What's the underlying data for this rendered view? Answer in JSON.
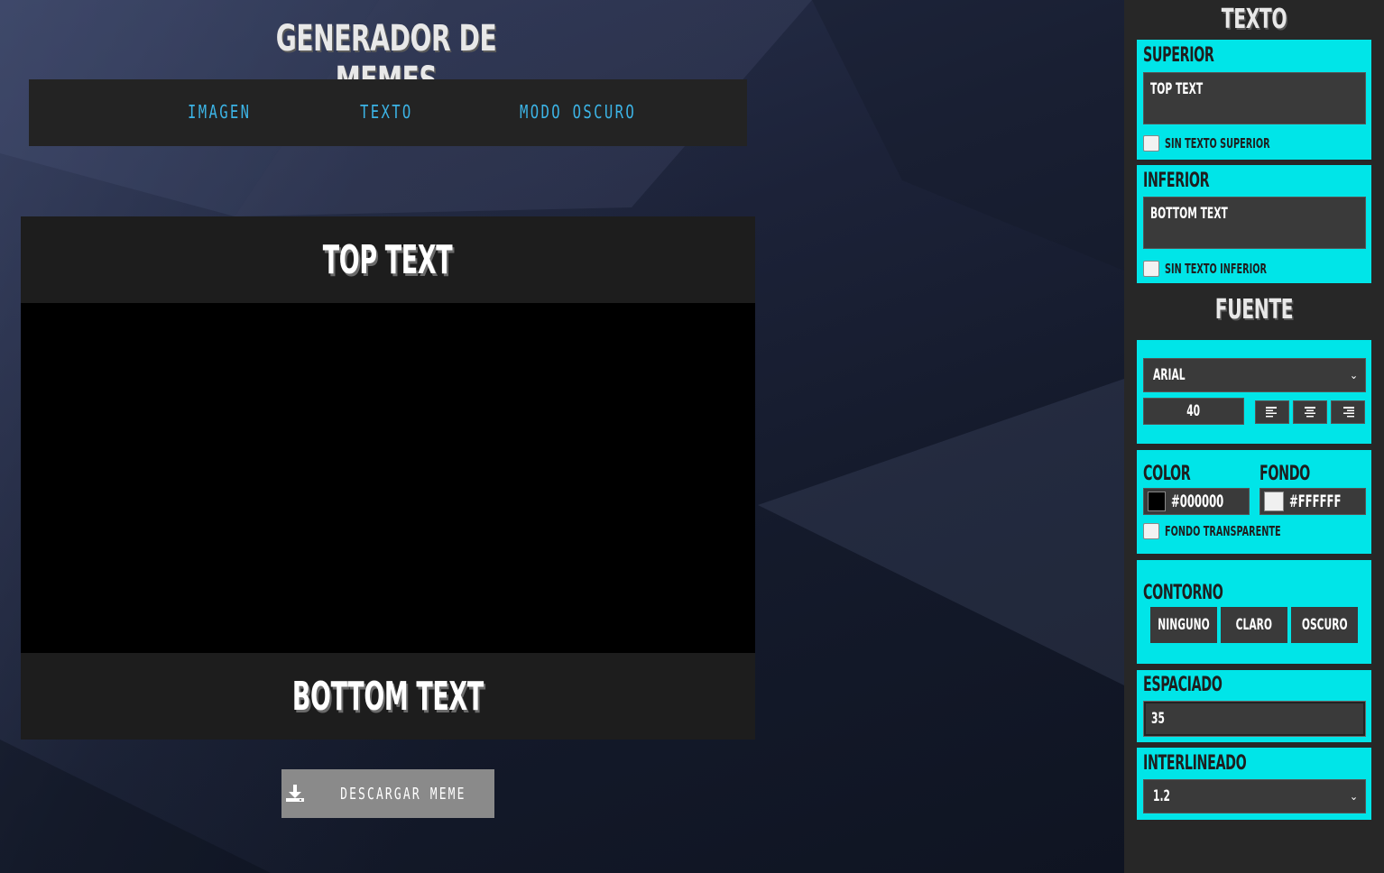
{
  "header": {
    "title": "GENERADOR DE MEMES",
    "nav": [
      {
        "label": "IMAGEN"
      },
      {
        "label": "TEXTO"
      },
      {
        "label": "MODO OSCURO"
      }
    ]
  },
  "meme": {
    "top_text": "TOP TEXT",
    "bottom_text": "BOTTOM TEXT"
  },
  "download": {
    "label": "DESCARGAR MEME",
    "icon": "download-icon"
  },
  "sidebar": {
    "title": "TEXTO",
    "superior": {
      "label": "SUPERIOR",
      "value": "TOP TEXT",
      "checkbox_label": "SIN TEXTO SUPERIOR"
    },
    "inferior": {
      "label": "INFERIOR",
      "value": "BOTTOM TEXT",
      "checkbox_label": "SIN TEXTO INFERIOR"
    },
    "font_title": "FUENTE",
    "font": {
      "family": "ARIAL",
      "size": "40",
      "align_icons": [
        "align-left-icon",
        "align-center-icon",
        "align-right-icon"
      ]
    },
    "colors": {
      "color_label": "COLOR",
      "color_value": "#000000",
      "bg_label": "FONDO",
      "bg_value": "#FFFFFF",
      "transparent_label": "FONDO TRANSPARENTE"
    },
    "outline": {
      "label": "CONTORNO",
      "options": [
        "NINGUNO",
        "CLARO",
        "OSCURO"
      ]
    },
    "spacing": {
      "label": "ESPACIADO",
      "value": "35"
    },
    "line_height": {
      "label": "INTERLINEADO",
      "value": "1.2"
    }
  },
  "theme": {
    "accent": "#00e5e8",
    "nav_link": "#3cb4e6",
    "sidebar_bg": "#272727",
    "panel_bg": "#00e5e8"
  }
}
